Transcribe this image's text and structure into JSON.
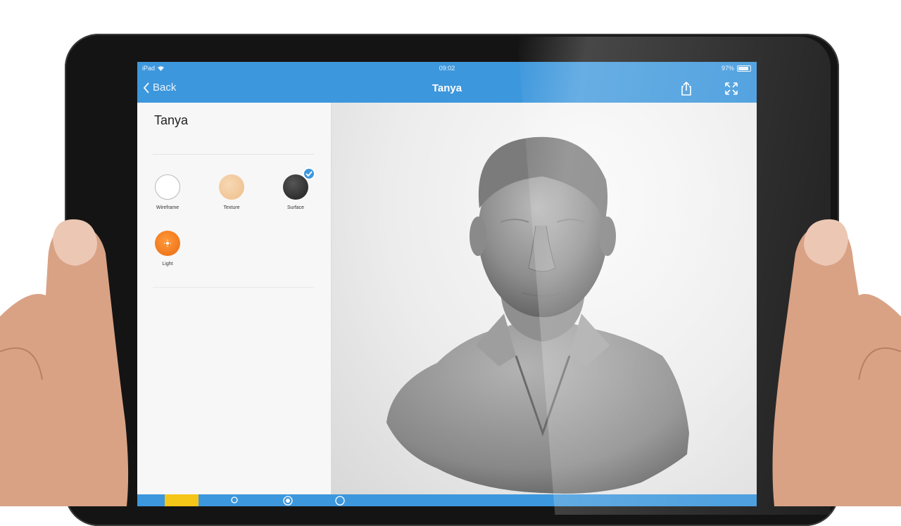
{
  "status_bar": {
    "device": "iPad",
    "time": "09:02",
    "battery": "97%",
    "battery_level": 0.97
  },
  "nav": {
    "back_label": "Back",
    "title": "Tanya",
    "share_icon": "share-icon",
    "fullscreen_icon": "expand-icon"
  },
  "sidebar": {
    "model_name": "Tanya",
    "render_modes": [
      {
        "label": "Wireframe",
        "color": "#ffffff",
        "selected": false
      },
      {
        "label": "Texture",
        "color": "#f2c79a",
        "selected": false
      },
      {
        "label": "Surface",
        "color": "#2e2e2e",
        "selected": true
      },
      {
        "label": "Light",
        "color": "#f57c1f",
        "selected": false
      }
    ]
  },
  "colors": {
    "accent": "#3d97dc",
    "toolbar_active": "#f5c518"
  },
  "toolbar": {
    "tools": [
      "folder-icon",
      "person-icon",
      "circle-icon",
      "info-icon"
    ]
  }
}
